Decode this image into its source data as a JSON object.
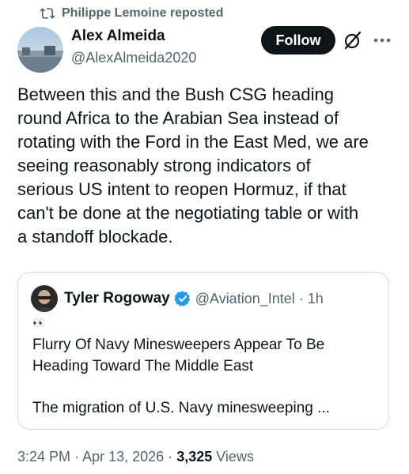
{
  "repost": {
    "text": "Philippe Lemoine reposted"
  },
  "author": {
    "name": "Alex Almeida",
    "handle": "@AlexAlmeida2020"
  },
  "actions": {
    "follow_label": "Follow"
  },
  "tweet": {
    "text": "Between this and the Bush CSG heading\nround Africa to the Arabian Sea instead of\nrotating with the Ford in the East Med, we are\nseeing reasonably strong indicators of\nserious US intent to reopen Hormuz, if that\ncan't be done at the negotiating table or with\na standoff blockade."
  },
  "quote": {
    "name": "Tyler Rogoway",
    "handle": "@Aviation_Intel",
    "separator": "·",
    "time": "1h",
    "emoji": "👀",
    "title": "Flurry Of Navy Minesweepers Appear To Be\nHeading Toward The Middle East",
    "snippet": "The migration of U.S. Navy minesweeping ..."
  },
  "meta": {
    "time": "3:24 PM",
    "separator1": "·",
    "date": "Apr 13, 2026",
    "separator2": "·",
    "views_count": "3,325",
    "views_label": "Views"
  },
  "colors": {
    "text": "#0f1419",
    "secondary": "#536471",
    "verified": "#1d9bf0",
    "border": "#cfd9de",
    "button_bg": "#0f1419"
  },
  "icons": [
    "repost-icon",
    "grok-icon",
    "more-icon",
    "verified-badge-icon"
  ]
}
